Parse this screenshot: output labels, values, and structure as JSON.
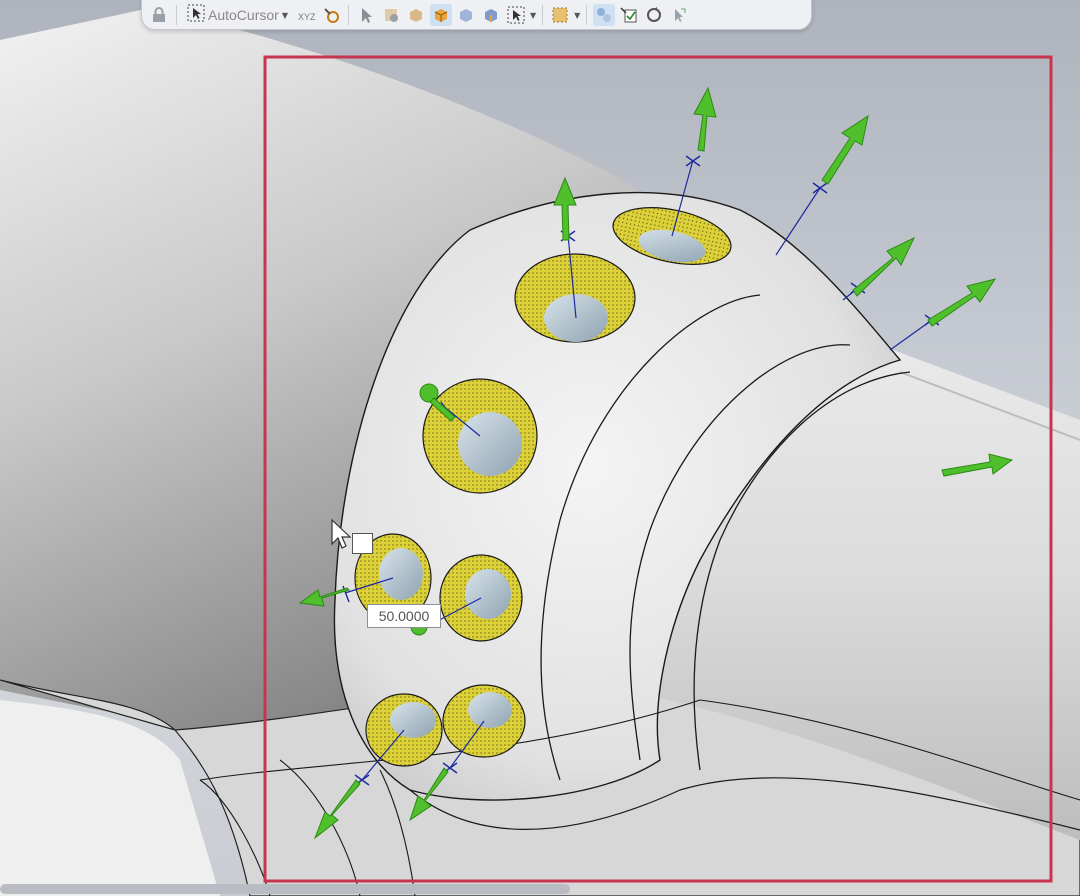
{
  "toolbar": {
    "autocursor_label": "AutoCursor",
    "icons": [
      "lock-icon",
      "autocursor-select-icon",
      "xyz-axis-icon",
      "snap-settings-icon",
      "arrow-select-icon",
      "component-icon",
      "part-icon",
      "body-icon",
      "face-icon",
      "edge-icon",
      "box-select-icon",
      "lasso-select-icon",
      "selection-filter-icon",
      "pick-list-icon",
      "cycle-icon",
      "pick-arrow-icon"
    ]
  },
  "dimension": {
    "value": "50.0000"
  },
  "colors": {
    "selection_box": "#c8344f",
    "arrow": "#4fc02c",
    "hole_face": "#ddd13a",
    "axis_line": "#1a2aa0"
  }
}
